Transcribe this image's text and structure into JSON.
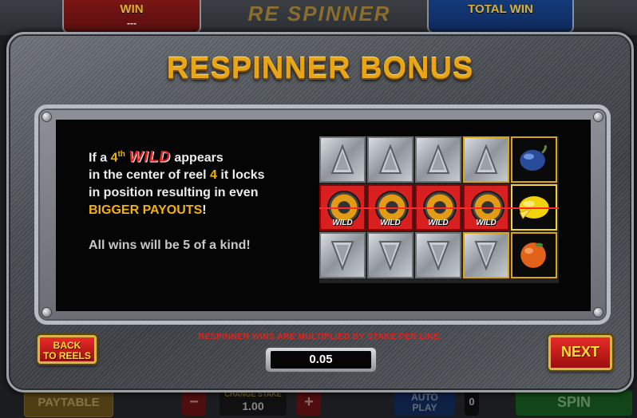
{
  "top": {
    "win_label": "WIN",
    "win_value": "---",
    "total_win_label": "TOTAL WIN",
    "logo_text": "RE SPINNER"
  },
  "dialog": {
    "title": "RESPINNER BONUS",
    "desc_if_a": "If a ",
    "desc_4th": "4",
    "desc_th": "th",
    "desc_wild": "WILD",
    "desc_appears": " appears",
    "desc_line2a": "in the center of reel ",
    "desc_reel_num": "4",
    "desc_line2b": " it locks",
    "desc_line3": "in position resulting in even",
    "desc_bigger": "BIGGER PAYOUTS",
    "desc_excl": "!",
    "desc_all_wins": "All wins will be 5 of a kind!",
    "reels": {
      "wild_label": "WILD",
      "row_top": [
        "arrow-up",
        "arrow-up",
        "arrow-up",
        "arrow-up",
        "plum"
      ],
      "row_mid": [
        "wild",
        "wild",
        "wild",
        "wild",
        "lemon"
      ],
      "row_bot": [
        "arrow-down",
        "arrow-down",
        "arrow-down",
        "arrow-down",
        "orange"
      ]
    },
    "back_button_line1": "BACK",
    "back_button_line2": "TO REELS",
    "multiplier_note": "RESPINNER WINS ARE MULTIPLIED BY STAKE PER LINE.",
    "stake_per_line_value": "0.05",
    "next_button": "NEXT"
  },
  "bottom": {
    "paytable": "PAYTABLE",
    "minus": "−",
    "plus": "+",
    "change_stake_label": "CHANGE STAKE",
    "stake_value": "1.00",
    "autoplay_line1": "AUTO",
    "autoplay_line2": "PLAY",
    "autoplay_count": "0",
    "spin": "SPIN"
  },
  "colors": {
    "title_gold": "#e8a617",
    "wild_red": "#e21d1d",
    "highlight_yellow": "#f2b20d",
    "note_red": "#e0231f",
    "button_red": "#c81c1c",
    "button_text": "#ffde3a"
  }
}
